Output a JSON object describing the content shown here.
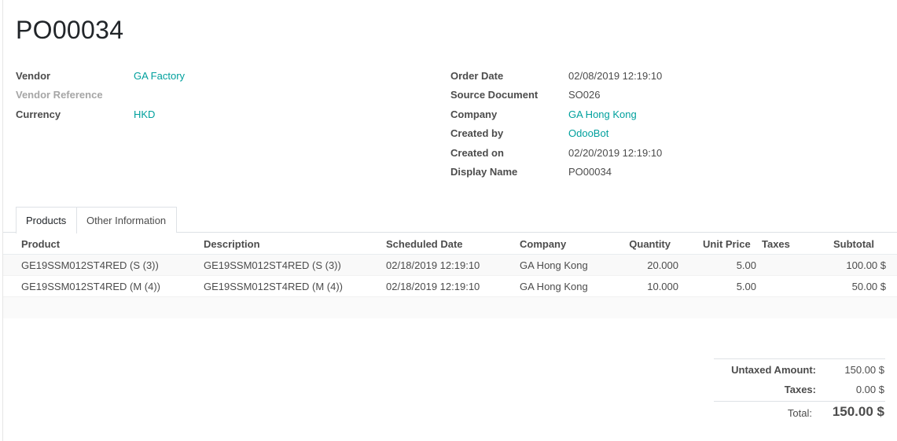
{
  "record": {
    "title": "PO00034"
  },
  "left_fields": [
    {
      "label": "Vendor",
      "value": "GA Factory"
    },
    {
      "label": "Vendor Reference",
      "value": ""
    },
    {
      "label": "Currency",
      "value": "HKD"
    }
  ],
  "right_fields": [
    {
      "label": "Order Date",
      "value": "02/08/2019 12:19:10"
    },
    {
      "label": "Source Document",
      "value": "SO026"
    },
    {
      "label": "Company",
      "value": "GA Hong Kong"
    },
    {
      "label": "Created by",
      "value": "OdooBot"
    },
    {
      "label": "Created on",
      "value": "02/20/2019 12:19:10"
    },
    {
      "label": "Display Name",
      "value": "PO00034"
    }
  ],
  "tabs": [
    {
      "label": "Products",
      "active": true
    },
    {
      "label": "Other Information",
      "active": false
    }
  ],
  "lines": {
    "columns": [
      "Product",
      "Description",
      "Scheduled Date",
      "Company",
      "Quantity",
      "Unit Price",
      "Taxes",
      "Subtotal"
    ],
    "rows": [
      {
        "product": "GE19SSM012ST4RED (S (3))",
        "description": "GE19SSM012ST4RED (S (3))",
        "scheduled_date": "02/18/2019 12:19:10",
        "company": "GA Hong Kong",
        "quantity": "20.000",
        "unit_price": "5.00",
        "taxes": "",
        "subtotal": "100.00 $"
      },
      {
        "product": "GE19SSM012ST4RED (M (4))",
        "description": "GE19SSM012ST4RED (M (4))",
        "scheduled_date": "02/18/2019 12:19:10",
        "company": "GA Hong Kong",
        "quantity": "10.000",
        "unit_price": "5.00",
        "taxes": "",
        "subtotal": "50.00 $"
      }
    ]
  },
  "totals": {
    "untaxed_label": "Untaxed Amount:",
    "untaxed_value": "150.00 $",
    "taxes_label": "Taxes:",
    "taxes_value": "0.00 $",
    "total_label": "Total:",
    "total_value": "150.00 $"
  },
  "colors": {
    "link": "#00A09D",
    "text": "#4c4c4c",
    "muted": "#a6a6a6"
  }
}
